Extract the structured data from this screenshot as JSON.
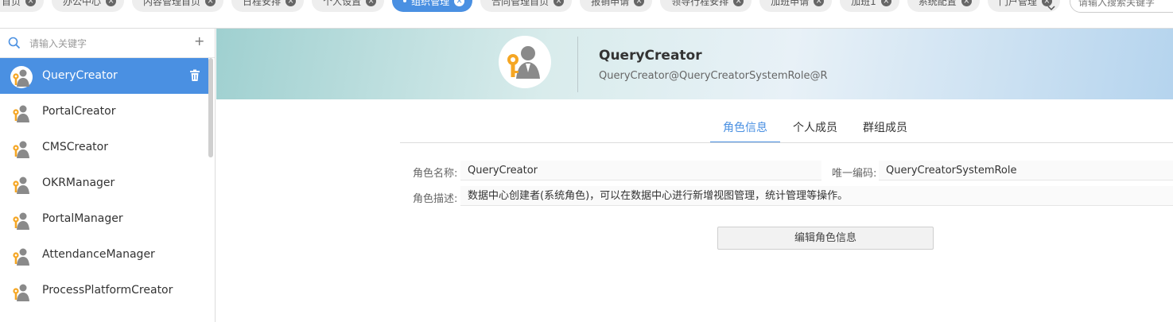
{
  "top_tabs": [
    {
      "label": "首页",
      "active": false
    },
    {
      "label": "办公中心",
      "active": false
    },
    {
      "label": "内容管理首页",
      "active": false
    },
    {
      "label": "日程安排",
      "active": false
    },
    {
      "label": "个人设置",
      "active": false
    },
    {
      "label": "组织管理",
      "active": true
    },
    {
      "label": "合同管理首页",
      "active": false
    },
    {
      "label": "报销申请",
      "active": false
    },
    {
      "label": "领导行程安排",
      "active": false
    },
    {
      "label": "加班申请",
      "active": false
    },
    {
      "label": "加班1",
      "active": false
    },
    {
      "label": "系统配置",
      "active": false
    },
    {
      "label": "门户管理",
      "active": false
    }
  ],
  "global_search": {
    "placeholder": "请输入搜索关键字"
  },
  "sidebar": {
    "search_placeholder": "请输入关键字",
    "roles": [
      {
        "label": "QueryCreator",
        "selected": true
      },
      {
        "label": "PortalCreator",
        "selected": false
      },
      {
        "label": "CMSCreator",
        "selected": false
      },
      {
        "label": "OKRManager",
        "selected": false
      },
      {
        "label": "PortalManager",
        "selected": false
      },
      {
        "label": "AttendanceManager",
        "selected": false
      },
      {
        "label": "ProcessPlatformCreator",
        "selected": false
      }
    ]
  },
  "role": {
    "name": "QueryCreator",
    "distinguished_name": "QueryCreator@QueryCreatorSystemRole@R"
  },
  "detail_tabs": [
    {
      "label": "角色信息",
      "active": true
    },
    {
      "label": "个人成员",
      "active": false
    },
    {
      "label": "群组成员",
      "active": false
    }
  ],
  "fields": {
    "name_label": "角色名称:",
    "name_value": "QueryCreator",
    "code_label": "唯一编码:",
    "code_value": "QueryCreatorSystemRole",
    "desc_label": "角色描述:",
    "desc_value": "数据中心创建者(系统角色)，可以在数据中心进行新增视图管理，统计管理等操作。"
  },
  "edit_button_label": "编辑角色信息",
  "colors": {
    "accent": "#4a90e2",
    "avatar_orange": "#f5a623",
    "avatar_gray": "#8a8a8a"
  }
}
